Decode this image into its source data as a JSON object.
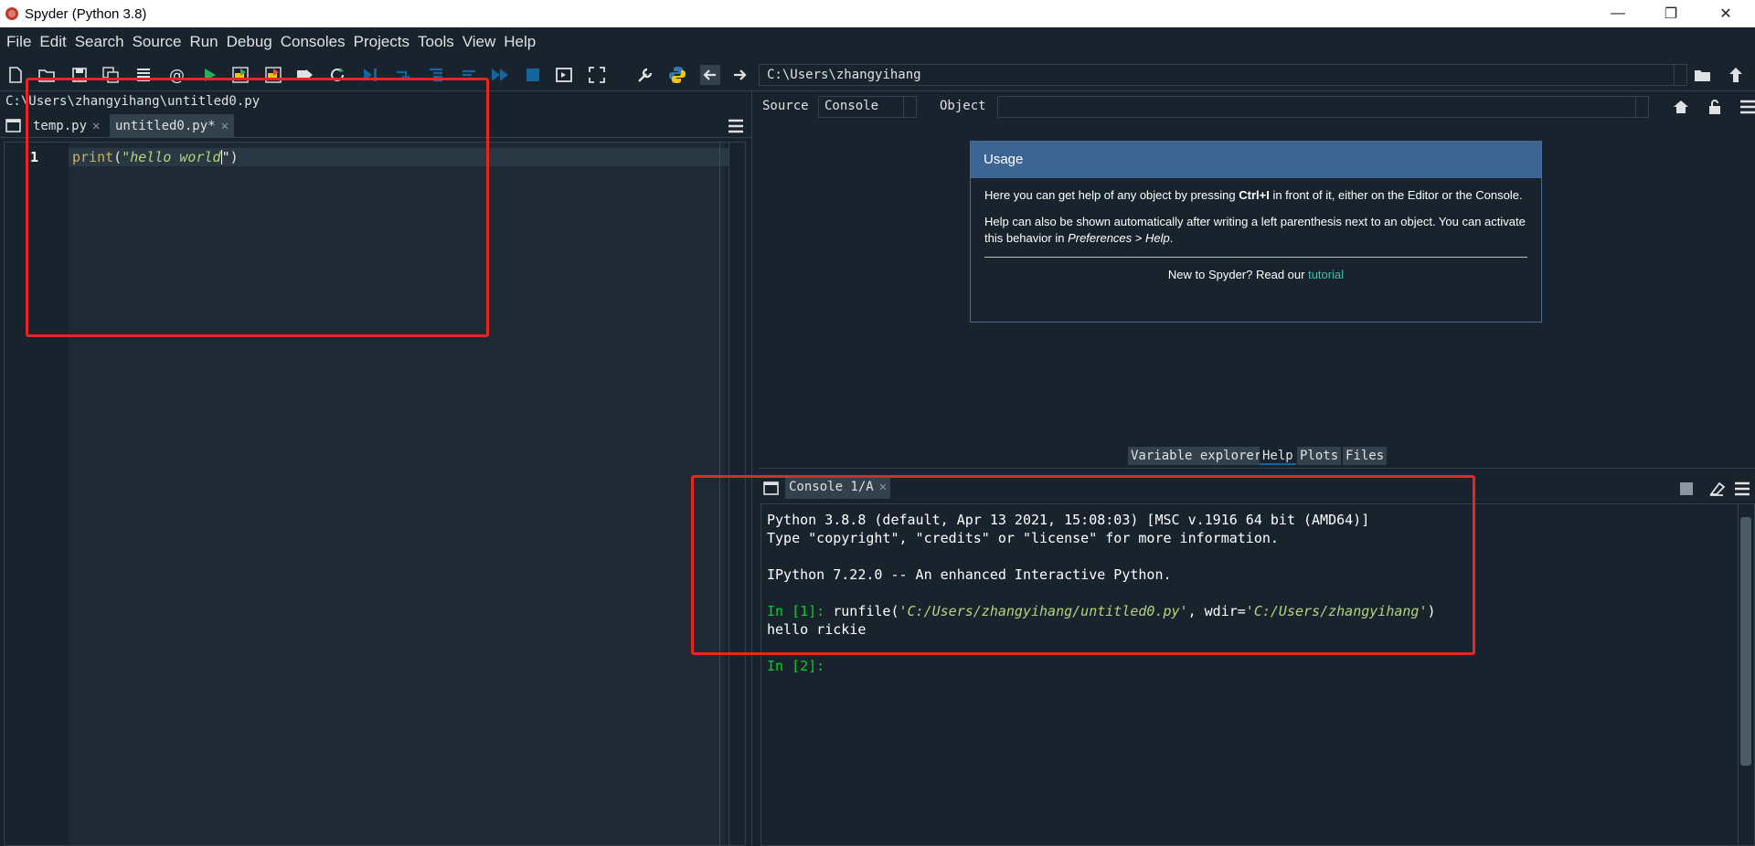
{
  "window": {
    "title": "Spyder (Python 3.8)",
    "minimize_glyph": "—",
    "restore_glyph": "❐",
    "close_glyph": "✕"
  },
  "menu": [
    "File",
    "Edit",
    "Search",
    "Source",
    "Run",
    "Debug",
    "Consoles",
    "Projects",
    "Tools",
    "View",
    "Help"
  ],
  "toolbar": {
    "working_dir": "C:\\Users\\zhangyihang",
    "icons": [
      "new-file-icon",
      "open-file-icon",
      "save-icon",
      "save-all-icon",
      "outline-icon",
      "at-icon",
      "run-icon",
      "run-cell-icon",
      "run-cell-advance-icon",
      "run-selection-icon",
      "rerun-icon",
      "debug-icon",
      "step-icon",
      "step-into-icon",
      "step-return-icon",
      "continue-icon",
      "stop-icon",
      "maximize-pane-icon",
      "fullscreen-icon",
      "wrench-icon",
      "python-icon",
      "back-arrow-icon",
      "forward-arrow-icon"
    ]
  },
  "editor": {
    "file_path": "C:\\Users\\zhangyihang\\untitled0.py",
    "tabs": [
      {
        "label": "temp.py",
        "active": false
      },
      {
        "label": "untitled0.py*",
        "active": true
      }
    ],
    "lines": [
      {
        "number": "1",
        "fn": "print",
        "open": "(",
        "string": "\"hello world",
        "close": "\")"
      }
    ]
  },
  "help": {
    "source_label": "Source",
    "source_value": "Console",
    "object_label": "Object",
    "object_value": "",
    "usage_title": "Usage",
    "usage_p1_a": "Here you can get help of any object by pressing ",
    "usage_p1_b": "Ctrl+I",
    "usage_p1_c": " in front of it, either on the Editor or the Console.",
    "usage_p2_a": "Help can also be shown automatically after writing a left parenthesis next to an object. You can activate this behavior in ",
    "usage_p2_b": "Preferences > Help",
    "usage_p2_c": ".",
    "usage_foot_a": "New to Spyder? Read our ",
    "usage_foot_link": "tutorial",
    "tabs": [
      "Variable explorer",
      "Help",
      "Plots",
      "Files"
    ],
    "active_tab": "Help"
  },
  "console": {
    "tab_label": "Console 1/A",
    "line1": "Python 3.8.8 (default, Apr 13 2021, 15:08:03) [MSC v.1916 64 bit (AMD64)]",
    "line2": "Type \"copyright\", \"credits\" or \"license\" for more information.",
    "line3": "IPython 7.22.0 -- An enhanced Interactive Python.",
    "prompt1": "In [1]:",
    "cmd_a": " runfile(",
    "cmd_arg1": "'C:/Users/zhangyihang/untitled0.py'",
    "cmd_b": ", wdir=",
    "cmd_arg2": "'C:/Users/zhangyihang'",
    "cmd_c": ")",
    "output": "hello rickie",
    "prompt2": "In [2]:"
  },
  "colors": {
    "background": "#19232d",
    "annotation": "#e8251f",
    "prompt": "#00d32c",
    "usage_header": "#3d6593"
  }
}
